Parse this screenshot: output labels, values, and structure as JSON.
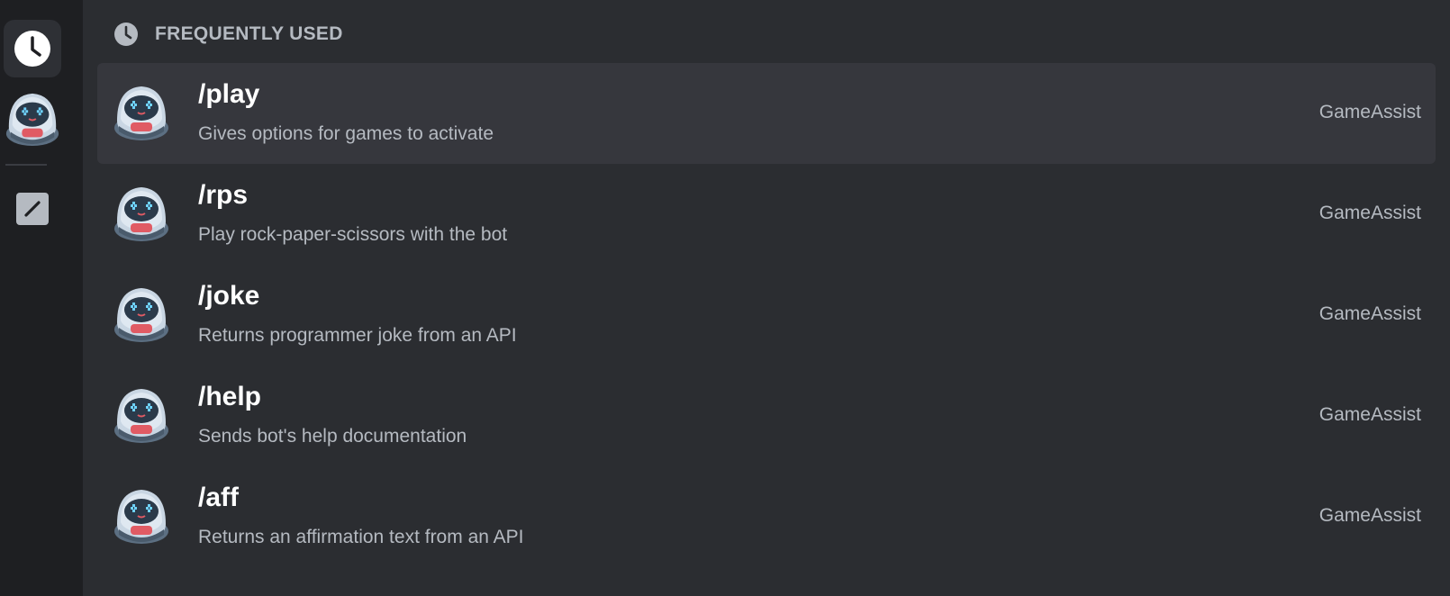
{
  "rail": {
    "items": [
      {
        "name": "frequently-used",
        "icon": "clock-icon",
        "active": true
      },
      {
        "name": "gameassist",
        "icon": "bot-avatar-icon",
        "active": false
      }
    ],
    "extra_icon": "edit-icon"
  },
  "section": {
    "title": "FREQUENTLY USED",
    "icon": "clock-icon"
  },
  "commands": [
    {
      "name": "/play",
      "description": "Gives options for games to activate",
      "source": "GameAssist"
    },
    {
      "name": "/rps",
      "description": "Play rock-paper-scissors with the bot",
      "source": "GameAssist"
    },
    {
      "name": "/joke",
      "description": "Returns programmer joke from an API",
      "source": "GameAssist"
    },
    {
      "name": "/help",
      "description": "Sends bot's help documentation",
      "source": "GameAssist"
    },
    {
      "name": "/aff",
      "description": "Returns an affirmation text from an API",
      "source": "GameAssist"
    }
  ],
  "colors": {
    "background": "#2b2d31",
    "rail_background": "#1e1f22",
    "selected_row": "#36373d",
    "primary_text": "#ffffff",
    "secondary_text": "#b5bac1",
    "bot_red": "#e05b64"
  }
}
